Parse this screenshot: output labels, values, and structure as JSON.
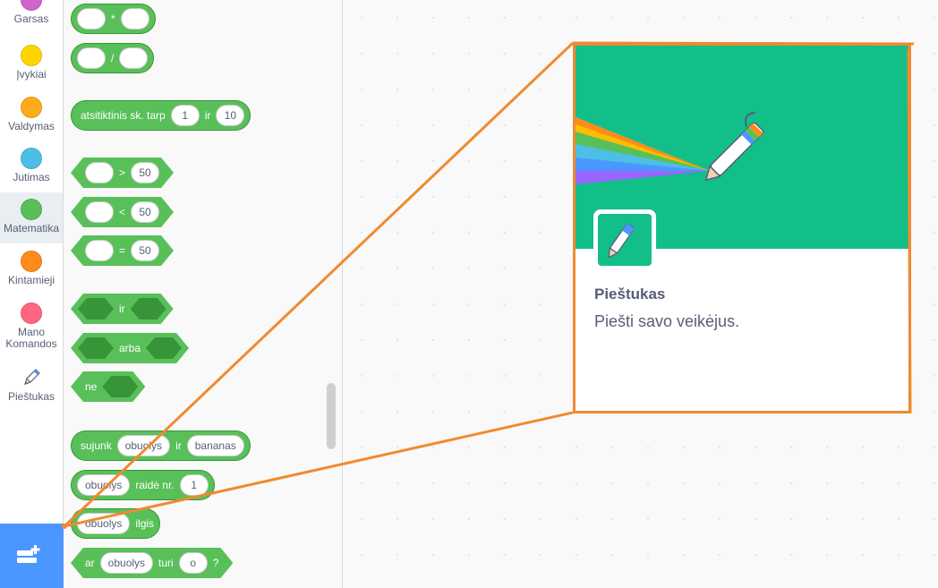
{
  "categories": [
    {
      "label": "Garsas",
      "color": "#cf63cf"
    },
    {
      "label": "Įvykiai",
      "color": "#ffd500"
    },
    {
      "label": "Valdymas",
      "color": "#ffab19"
    },
    {
      "label": "Jutimas",
      "color": "#4cbfe6"
    },
    {
      "label": "Matematika",
      "color": "#59c059"
    },
    {
      "label": "Kintamieji",
      "color": "#ff8c1a"
    },
    {
      "label": "Mano\nKomandos",
      "label_line1": "Mano",
      "label_line2": "Komandos",
      "color": "#ff6680"
    },
    {
      "label": "Pieštukas",
      "icon": "pen-icon"
    }
  ],
  "blocks": {
    "multiply": {
      "op": "*"
    },
    "divide": {
      "op": "/"
    },
    "random": {
      "text": "atsitiktinis sk. tarp",
      "from": "1",
      "and": "ir",
      "to": "10"
    },
    "greater": {
      "op": ">",
      "value": "50"
    },
    "less": {
      "op": "<",
      "value": "50"
    },
    "equal": {
      "op": "=",
      "value": "50"
    },
    "and": {
      "text": "ir"
    },
    "or": {
      "text": "arba"
    },
    "not": {
      "text": "ne"
    },
    "join": {
      "text": "sujunk",
      "a": "obuolys",
      "mid": "ir",
      "b": "bananas"
    },
    "letter_of": {
      "a": "obuolys",
      "text": "raidė nr.",
      "n": "1"
    },
    "length": {
      "a": "obuolys",
      "text": "ilgis"
    },
    "contains": {
      "prefix": "ar",
      "a": "obuolys",
      "text": "turi",
      "b": "o",
      "suffix": "?"
    }
  },
  "extension_card": {
    "title": "Pieštukas",
    "description": "Piešti savo veikėjus.",
    "banner_color": "#12bf89"
  },
  "colors": {
    "operator_green": "#59c059",
    "highlight_orange": "#f08a2e",
    "add_extension_blue": "#4c97ff"
  },
  "icons": {
    "add_extension": "add-extension-icon",
    "pen": "pen-icon"
  }
}
